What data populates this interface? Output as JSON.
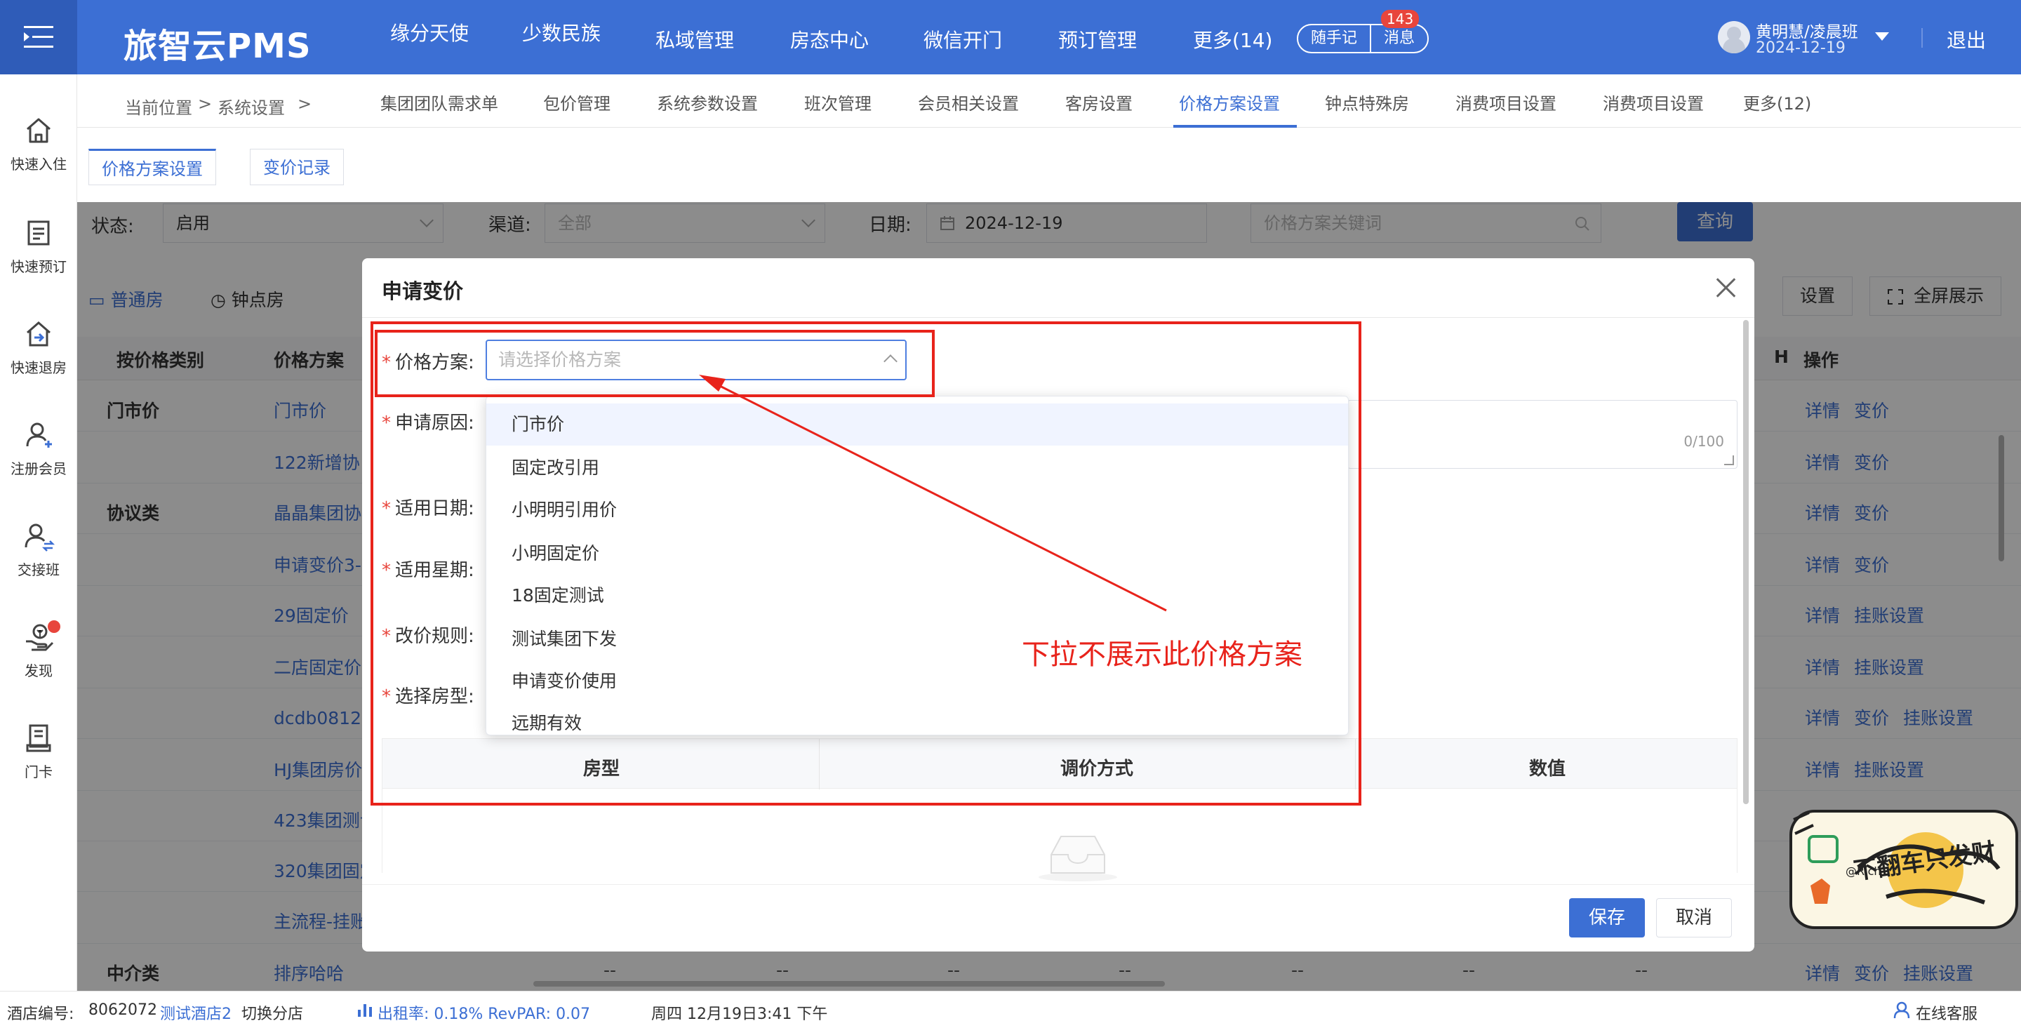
{
  "app": {
    "brand": "旅智云PMS"
  },
  "topnav": {
    "items": [
      "缘分天使",
      "少数民族",
      "私域管理",
      "房态中心",
      "微信开门",
      "预订管理",
      "更多(14)"
    ],
    "quick_note": "随手记",
    "messages": "消息",
    "message_count": "143",
    "user_name": "黄明慧/凌晨班",
    "user_date": "2024-12-19",
    "logout": "退出"
  },
  "sidebar": {
    "items": [
      {
        "label": "快速入住",
        "icon": "home-icon"
      },
      {
        "label": "快速预订",
        "icon": "booking-icon"
      },
      {
        "label": "快速退房",
        "icon": "checkout-icon"
      },
      {
        "label": "注册会员",
        "icon": "add-member-icon"
      },
      {
        "label": "交接班",
        "icon": "shift-icon"
      },
      {
        "label": "发现",
        "icon": "discover-icon"
      },
      {
        "label": "门卡",
        "icon": "card-icon"
      }
    ]
  },
  "breadcrumb": {
    "current": "当前位置",
    "sep": ">",
    "section": "系统设置",
    "sep2": ">"
  },
  "subnav": {
    "items": [
      "集团团队需求单",
      "包价管理",
      "系统参数设置",
      "班次管理",
      "会员相关设置",
      "客房设置",
      "价格方案设置",
      "钟点特殊房",
      "消费项目设置",
      "消费项目设置",
      "更多(12)"
    ],
    "active_index": 6
  },
  "page_tabs": [
    "价格方案设置",
    "变价记录"
  ],
  "filters": {
    "status_label": "状态:",
    "status_value": "启用",
    "channel_label": "渠道:",
    "channel_value": "全部",
    "date_label": "日期:",
    "date_value": "2024-12-19",
    "keyword_placeholder": "价格方案关键词",
    "query": "查询"
  },
  "room_tabs": {
    "normal": "普通房",
    "hourly": "钟点房"
  },
  "toolbar": {
    "settings": "设置",
    "fullscreen": "全屏展示"
  },
  "table": {
    "headers": {
      "category": "按价格类别",
      "plan": "价格方案",
      "h": "H",
      "ops": "操作"
    },
    "rows": [
      {
        "category": "门市价",
        "plan": "门市价",
        "ops": [
          "详情",
          "变价"
        ]
      },
      {
        "category": "",
        "plan": "122新增协",
        "ops": [
          "详情",
          "变价"
        ]
      },
      {
        "category": "协议类",
        "plan": "晶晶集团协",
        "ops": [
          "详情",
          "变价"
        ]
      },
      {
        "category": "",
        "plan": "申请变价3-",
        "ops": [
          "详情",
          "变价"
        ]
      },
      {
        "category": "",
        "plan": "29固定价",
        "ops": [
          "详情",
          "挂账设置"
        ]
      },
      {
        "category": "",
        "plan": "二店固定价",
        "ops": [
          "详情",
          "挂账设置"
        ]
      },
      {
        "category": "",
        "plan": "dcdb0812居",
        "ops": [
          "详情",
          "变价",
          "挂账设置"
        ]
      },
      {
        "category": "",
        "plan": "HJ集团房价",
        "ops": [
          "详情",
          "挂账设置"
        ]
      },
      {
        "category": "",
        "plan": "423集团测试",
        "ops": []
      },
      {
        "category": "",
        "plan": "320集团固定",
        "ops": []
      },
      {
        "category": "",
        "plan": "主流程-挂账",
        "ops": []
      },
      {
        "category": "中介类",
        "plan": "排序哈哈",
        "ops": [
          "详情",
          "变价",
          "挂账设置"
        ]
      }
    ],
    "dash": "--"
  },
  "modal": {
    "title": "申请变价",
    "fields": {
      "plan": "价格方案:",
      "reason": "申请原因:",
      "apply_date": "适用日期:",
      "apply_week": "适用星期:",
      "rule": "改价规则:",
      "room_type": "选择房型:"
    },
    "plan_placeholder": "请选择价格方案",
    "reason_count": "0/100",
    "inner_table": {
      "room_type": "房型",
      "method": "调价方式",
      "value": "数值"
    },
    "save": "保存",
    "cancel": "取消"
  },
  "dropdown": {
    "options": [
      "门市价",
      "固定改引用",
      "小明明引用价",
      "小明固定价",
      "18固定测试",
      "测试集团下发",
      "申请变价使用",
      "远期有效"
    ],
    "hover_index": 0
  },
  "annotation": {
    "text": "下拉不展示此价格方案",
    "color": "#e8231b"
  },
  "statusbar": {
    "hotel_no_label": "酒店编号:",
    "hotel_no": "8062072",
    "hotel_name": "测试酒店2",
    "switch": "切换分店",
    "occupancy": "出租率:  0.18% RevPAR:  0.07",
    "datetime": "周四 12月19日3:41 下午",
    "support": "在线客服"
  },
  "sticker": {
    "text": "不翻车只发财",
    "handle": "@Rich"
  },
  "colors": {
    "primary": "#3c6fd4",
    "danger": "#e8453c"
  }
}
